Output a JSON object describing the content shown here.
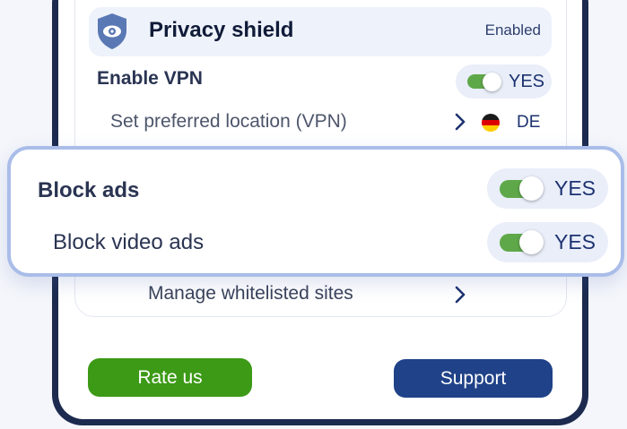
{
  "privacy_shield": {
    "title": "Privacy shield",
    "status": "Enabled",
    "icon": "eye-shield-icon"
  },
  "vpn": {
    "label": "Enable VPN",
    "toggle_on": true,
    "toggle_text": "YES",
    "location": {
      "label": "Set preferred location (VPN)",
      "country_code": "DE",
      "flag_icon": "germany-flag-icon"
    }
  },
  "ads": {
    "block_ads": {
      "label": "Block ads",
      "toggle_on": true,
      "toggle_text": "YES"
    },
    "block_video_ads": {
      "label": "Block video ads",
      "toggle_on": true,
      "toggle_text": "YES"
    }
  },
  "whitelist": {
    "label": "Manage whitelisted sites"
  },
  "buttons": {
    "rate_us": "Rate us",
    "support": "Support"
  },
  "colors": {
    "toggle_on": "#5fa84a",
    "rate_button": "#3c9a16",
    "support_button": "#1f4288",
    "highlight_border": "#aabde9",
    "frame": "#1c2a4f"
  }
}
